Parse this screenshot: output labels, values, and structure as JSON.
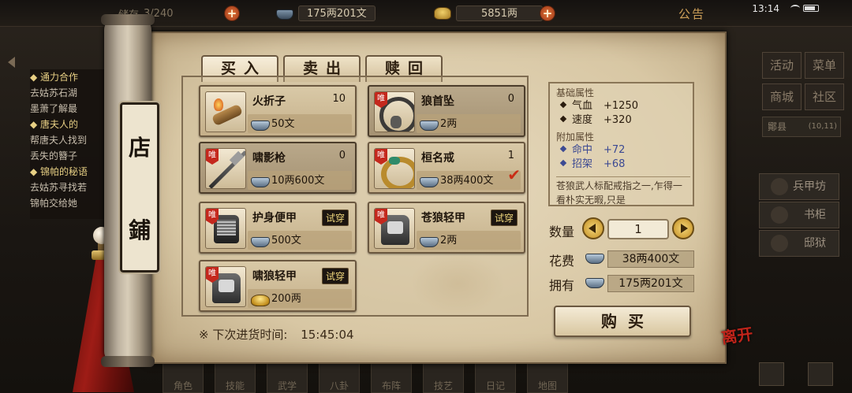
{
  "status_bar": {
    "bag_label": "储存",
    "bag_count": "3/240",
    "copper_money": "175两201文",
    "gold_ingots": "5851两",
    "notice": "公告",
    "clock": "13:14"
  },
  "quest_log": {
    "lines": [
      {
        "text": "◆ 通力合作",
        "highlight": true
      },
      {
        "text": "去姑苏石湖",
        "highlight": false
      },
      {
        "text": "墨萧了解最",
        "highlight": false
      },
      {
        "text": "◆ 唐夫人的",
        "highlight": true
      },
      {
        "text": "帮唐夫人找到",
        "highlight": false
      },
      {
        "text": "丢失的簪子",
        "highlight": false
      },
      {
        "text": "◆ 锦帕的秘语",
        "highlight": true
      },
      {
        "text": "去姑苏寻找若",
        "highlight": false
      },
      {
        "text": "锦帕交给她",
        "highlight": false
      }
    ]
  },
  "side_menu": {
    "activity": "活动",
    "menu": "菜单",
    "mall": "商城",
    "community": "社区",
    "location": "鄮县",
    "coords": "(10,11)",
    "shop_armor": "兵甲坊",
    "shop_cabinet": "书柜",
    "shop_prison": "邸狱"
  },
  "bottom_menu": [
    "角色",
    "技能",
    "武学",
    "八卦",
    "布阵",
    "技艺",
    "日记",
    "地图"
  ],
  "shop": {
    "plaque": [
      "店",
      "鋪"
    ],
    "tabs": [
      "买入",
      "卖出",
      "赎回"
    ],
    "items": [
      {
        "name": "火折子",
        "qty": "10",
        "price": "50文",
        "currency": "tael",
        "unique": false,
        "try_label": "",
        "icon": "torch-icon"
      },
      {
        "name": "狼首坠",
        "qty": "0",
        "price": "2两",
        "currency": "tael",
        "unique": true,
        "try_label": "",
        "icon": "necklace-icon"
      },
      {
        "name": "啸影枪",
        "qty": "0",
        "price": "10两600文",
        "currency": "tael",
        "unique": true,
        "try_label": "",
        "icon": "spear-icon"
      },
      {
        "name": "桓名戒",
        "qty": "1",
        "price": "38两400文",
        "currency": "tael",
        "unique": true,
        "try_label": "",
        "icon": "ring-icon"
      },
      {
        "name": "护身便甲",
        "qty": "",
        "price": "500文",
        "currency": "tael",
        "unique": true,
        "try_label": "试穿",
        "icon": "armor-icon"
      },
      {
        "name": "苍狼轻甲",
        "qty": "",
        "price": "2两",
        "currency": "tael",
        "unique": true,
        "try_label": "试穿",
        "icon": "armor-icon"
      },
      {
        "name": "啸狼轻甲",
        "qty": "",
        "price": "200两",
        "currency": "gold",
        "unique": true,
        "try_label": "试穿",
        "icon": "armor-icon"
      }
    ],
    "unique_tag": "唯",
    "restock_label": "※ 下次进货时间:",
    "restock_time": "15:45:04"
  },
  "detail": {
    "base_header": "基础属性",
    "base_stats": [
      {
        "name": "气血",
        "value": "+1250"
      },
      {
        "name": "速度",
        "value": "+320"
      }
    ],
    "extra_header": "附加属性",
    "extra_stats": [
      {
        "name": "命中",
        "value": "+72"
      },
      {
        "name": "招架",
        "value": "+68"
      }
    ],
    "description": "苍狼武人标配戒指之一,乍得一看朴实无暇,只是"
  },
  "purchase": {
    "qty_label": "数量",
    "qty_value": "1",
    "cost_label": "花费",
    "cost_value": "38两400文",
    "own_label": "拥有",
    "own_value": "175两201文",
    "buy_label": "购买",
    "leave_label": "离开"
  }
}
